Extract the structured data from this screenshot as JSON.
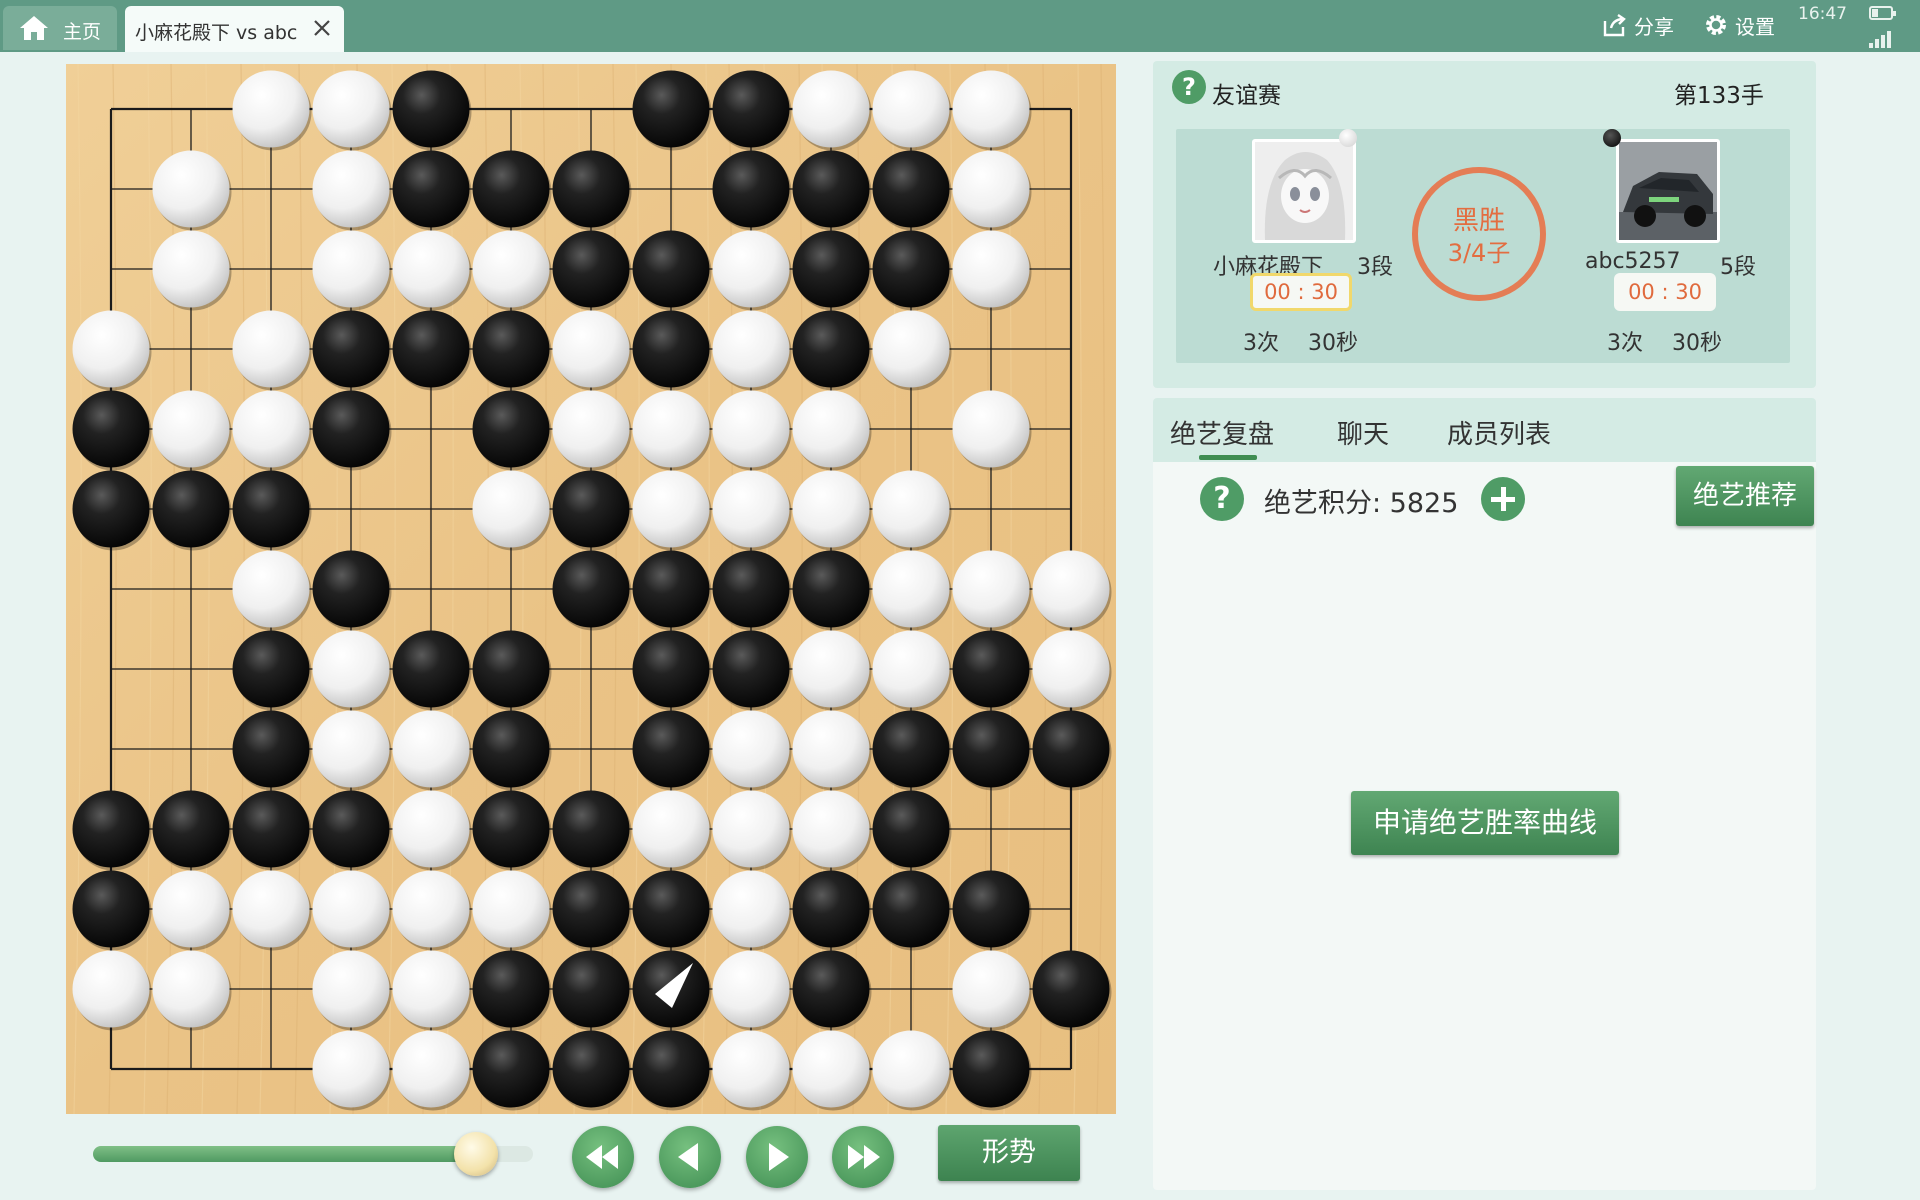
{
  "topbar": {
    "home_label": "主页",
    "game_tab_label": "小麻花殿下 vs abc",
    "share_label": "分享",
    "settings_label": "设置",
    "clock": "16:47",
    "battery_level": 0.35
  },
  "board": {
    "size": 13,
    "rows": [
      "..WWB..BBWWW.",
      ".W.WBBB.BBBW.",
      ".W.WWWBBWBBW.",
      "W.WBBBWBWBW..",
      "BWWB.BWWWW.W.",
      "BBB..WBWWWW..",
      "..WB..BBBBWWW",
      "..BWBB.BBWWBW",
      "..BWWB.BWWBBB",
      "BBBBWBBWWWB..",
      "BWWWWWBBWBBB.",
      "WW.WWBBBWB.WB",
      "...WWBBBWWWB."
    ],
    "last_move": {
      "row": 11,
      "col": 7
    },
    "stone_colors": {
      "black": "#111111",
      "white": "#f4f4f4",
      "wood": "#edc98c"
    }
  },
  "controls": {
    "progress": 0.87,
    "situation_label": "形势"
  },
  "match": {
    "help": "?",
    "type": "友谊赛",
    "move_count": "第133手",
    "black": {
      "name": "小麻花殿下",
      "rank": "3段",
      "time": "00 : 30",
      "byo_times": "3次",
      "byo_secs": "30秒"
    },
    "white": {
      "name": "abc5257",
      "rank": "5段",
      "time": "00 : 30",
      "byo_times": "3次",
      "byo_secs": "30秒"
    },
    "result_line1": "黑胜",
    "result_line2": "3/4子"
  },
  "tabs": [
    "绝艺复盘",
    "聊天",
    "成员列表"
  ],
  "review": {
    "help": "?",
    "score_label": "绝艺积分: 5825",
    "recommend_label": "绝艺推荐",
    "apply_label": "申请绝艺胜率曲线"
  },
  "colors": {
    "accent": "#4f9c66",
    "topbar": "#5f9a85",
    "seal": "#e47d55"
  }
}
